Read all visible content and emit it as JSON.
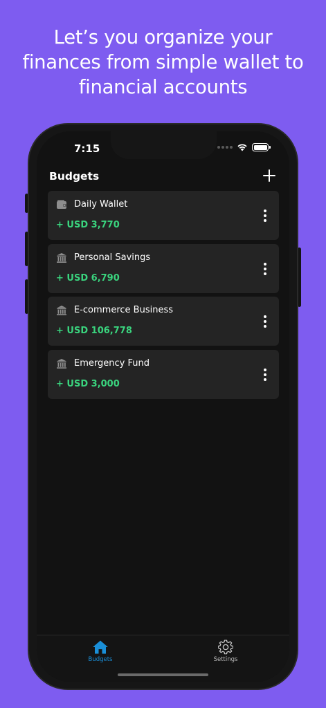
{
  "headline": "Let’s you organize your finances from simple wallet to financial accounts",
  "status_bar": {
    "time": "7:15"
  },
  "nav": {
    "title": "Budgets"
  },
  "budgets": [
    {
      "name": "Daily Wallet",
      "amount": "+ USD 3,770",
      "icon": "wallet-icon"
    },
    {
      "name": "Personal Savings",
      "amount": "+ USD 6,790",
      "icon": "bank-icon"
    },
    {
      "name": "E-commerce Business",
      "amount": "+ USD 106,778",
      "icon": "bank-icon"
    },
    {
      "name": "Emergency Fund",
      "amount": "+ USD 3,000",
      "icon": "bank-icon"
    }
  ],
  "tabs": [
    {
      "label": "Budgets",
      "icon": "home-icon",
      "active": true
    },
    {
      "label": "Settings",
      "icon": "gear-icon",
      "active": false
    }
  ],
  "colors": {
    "background": "#7e5cf0",
    "amount_positive": "#3ad47e",
    "tab_active": "#1a8fd8",
    "card": "#242424"
  }
}
